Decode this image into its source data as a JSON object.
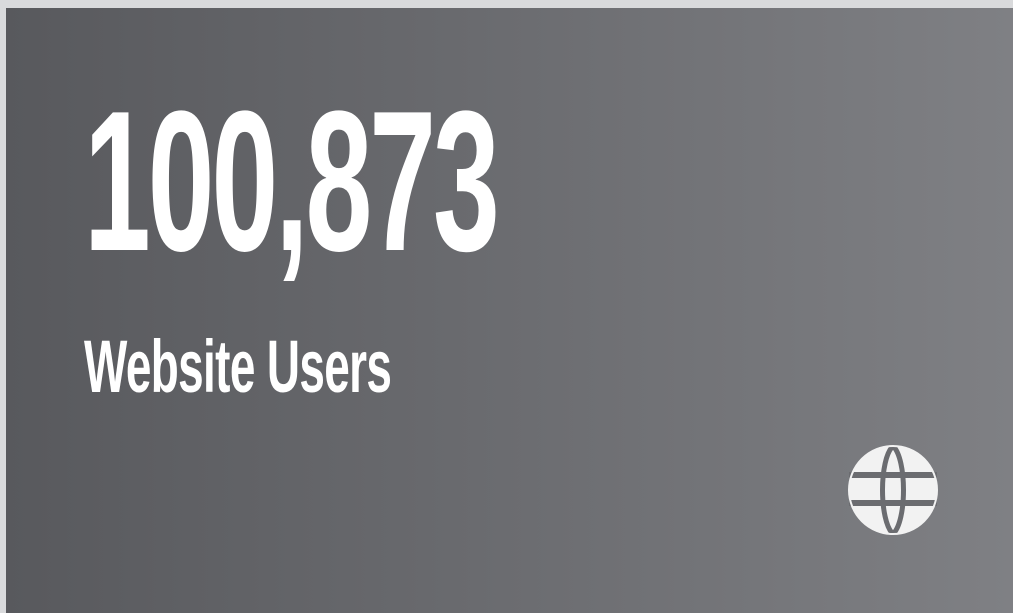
{
  "stat_card": {
    "value": "100,873",
    "label": "Website Users",
    "icon": "globe-icon",
    "colors": {
      "text": "#ffffff",
      "background_left": "#58595d",
      "background_right": "#7f8084",
      "outer_background": "#d9dadc"
    }
  }
}
